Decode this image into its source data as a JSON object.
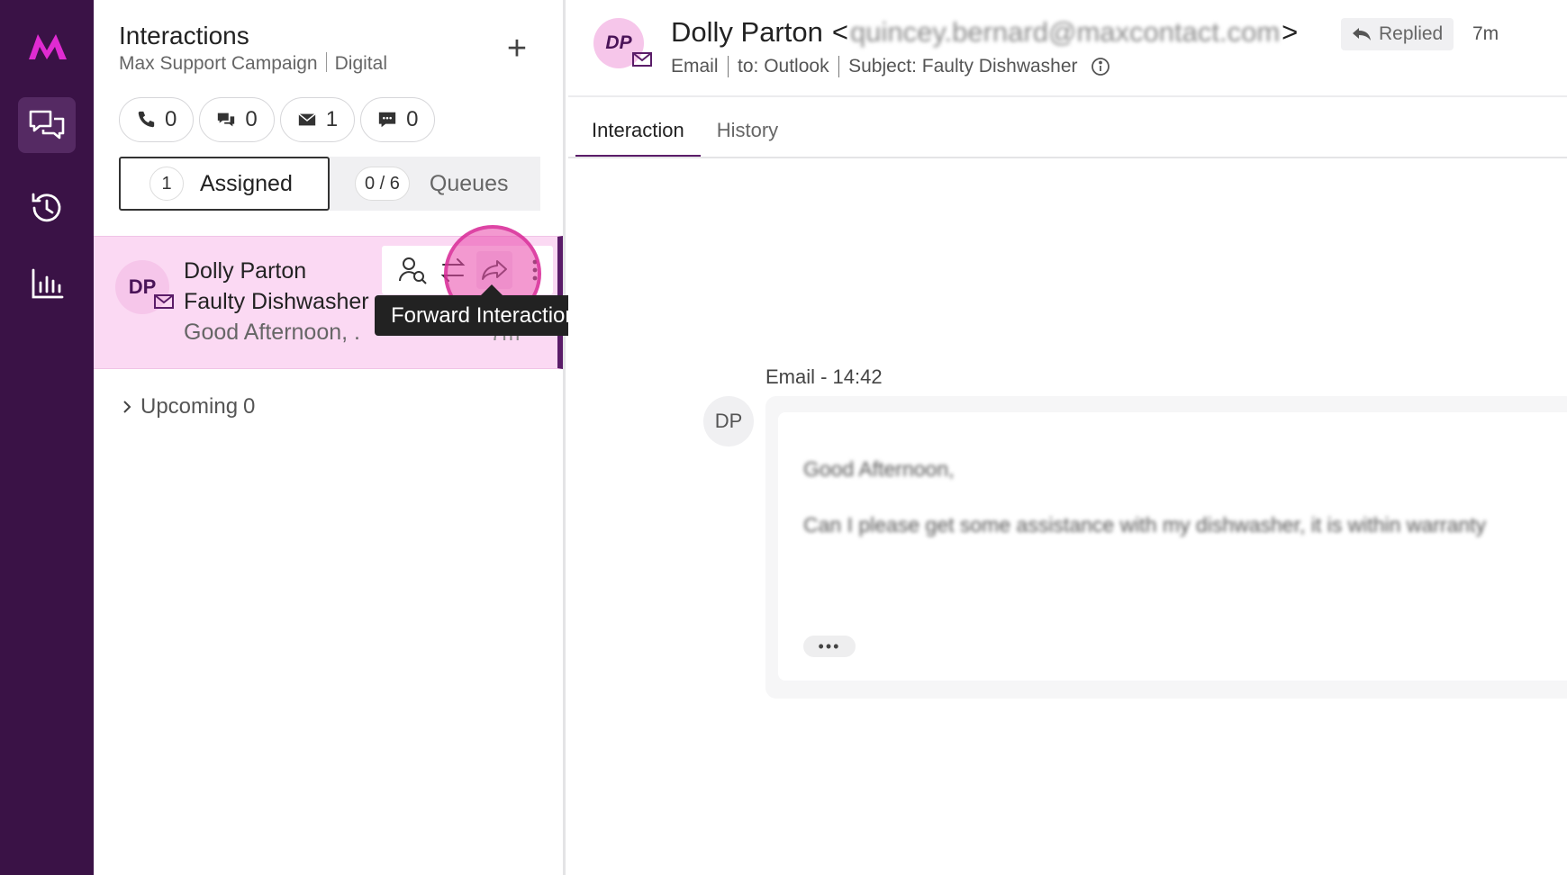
{
  "rail": {
    "logo": "M",
    "items": [
      {
        "name": "interactions",
        "icon": "chat-bubbles-icon",
        "active": true
      },
      {
        "name": "history",
        "icon": "history-icon",
        "active": false
      },
      {
        "name": "reports",
        "icon": "bar-chart-icon",
        "active": false
      }
    ],
    "bg_color": "#3a1246",
    "accent_color": "#e02bd2"
  },
  "panel": {
    "title": "Interactions",
    "campaign": "Max Support Campaign",
    "channel": "Digital",
    "add_label": "+",
    "channel_counts": [
      {
        "icon": "phone-icon",
        "count": "0"
      },
      {
        "icon": "chat-icon",
        "count": "0"
      },
      {
        "icon": "envelope-icon",
        "count": "1"
      },
      {
        "icon": "sms-icon",
        "count": "0"
      }
    ],
    "assigned": {
      "count": "1",
      "label": "Assigned"
    },
    "queues": {
      "count": "0 / 6",
      "label": "Queues"
    },
    "upcoming": {
      "label": "Upcoming",
      "count": "0"
    }
  },
  "card": {
    "initials": "DP",
    "name": "Dolly Parton",
    "subject": "Faulty Dishwasher",
    "preview": "Good Afternoon, .",
    "time": "7m",
    "actions": [
      {
        "name": "lookup-contact",
        "icon": "contact-search-icon"
      },
      {
        "name": "transfer",
        "icon": "transfer-icon"
      },
      {
        "name": "forward",
        "icon": "forward-icon"
      },
      {
        "name": "more",
        "icon": "more-vertical-icon"
      }
    ],
    "tooltip": "Forward Interaction",
    "highlight_color": "#ea46aa"
  },
  "header": {
    "initials": "DP",
    "name": "Dolly Parton",
    "email": "quincey.bernard@maxcontact.com",
    "status": "Replied",
    "time": "7m",
    "channel": "Email",
    "to": "to: Outlook",
    "subject": "Subject: Faulty Dishwasher"
  },
  "tabs": [
    {
      "label": "Interaction",
      "active": true
    },
    {
      "label": "History",
      "active": false
    }
  ],
  "message": {
    "label": "Email - 14:42",
    "initials": "DP",
    "line1": "Good Afternoon,",
    "line2": "Can I please get some assistance with my dishwasher, it is within warranty",
    "more": "•••"
  }
}
